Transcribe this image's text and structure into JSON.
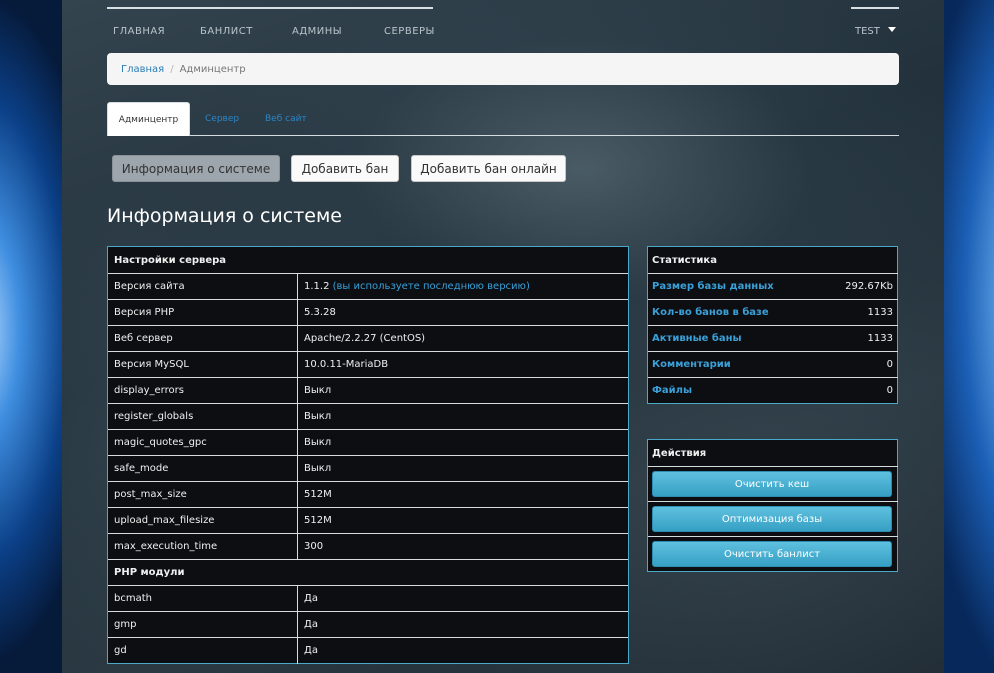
{
  "nav": {
    "items": [
      "ГЛАВНАЯ",
      "БАНЛИСТ",
      "АДМИНЫ",
      "СЕРВЕРЫ"
    ],
    "user": "TEST"
  },
  "breadcrumb": {
    "home": "Главная",
    "separator": "/",
    "current": "Админцентр"
  },
  "tabs": {
    "active": "Админцентр",
    "items": [
      "Сервер",
      "Веб сайт"
    ]
  },
  "buttons": {
    "system_info": "Информация о системе",
    "add_ban": "Добавить бан",
    "add_ban_online": "Добавить бан онлайн"
  },
  "page_title": "Информация о системе",
  "server_table": {
    "header": "Настройки сервера",
    "rows": [
      {
        "name": "Версия сайта",
        "value": "1.1.2",
        "note": "(вы используете последнюю версию)"
      },
      {
        "name": "Версия PHP",
        "value": "5.3.28"
      },
      {
        "name": "Веб сервер",
        "value": "Apache/2.2.27 (CentOS)"
      },
      {
        "name": "Версия MySQL",
        "value": "10.0.11-MariaDB"
      },
      {
        "name": "display_errors",
        "value": "Выкл"
      },
      {
        "name": "register_globals",
        "value": "Выкл"
      },
      {
        "name": "magic_quotes_gpc",
        "value": "Выкл"
      },
      {
        "name": "safe_mode",
        "value": "Выкл"
      },
      {
        "name": "post_max_size",
        "value": "512M"
      },
      {
        "name": "upload_max_filesize",
        "value": "512M"
      },
      {
        "name": "max_execution_time",
        "value": "300"
      }
    ],
    "modules_header": "PHP модули",
    "modules": [
      {
        "name": "bcmath",
        "value": "Да"
      },
      {
        "name": "gmp",
        "value": "Да"
      },
      {
        "name": "gd",
        "value": "Да"
      }
    ]
  },
  "stats": {
    "title": "Статистика",
    "rows": [
      {
        "label": "Размер базы данных",
        "value": "292.67Kb"
      },
      {
        "label": "Кол-во банов в базе",
        "value": "1133"
      },
      {
        "label": "Активные баны",
        "value": "1133"
      },
      {
        "label": "Комментарии",
        "value": "0"
      },
      {
        "label": "Файлы",
        "value": "0"
      }
    ]
  },
  "actions": {
    "title": "Действия",
    "buttons": [
      "Очистить кеш",
      "Оптимизация базы",
      "Очистить банлист"
    ]
  }
}
